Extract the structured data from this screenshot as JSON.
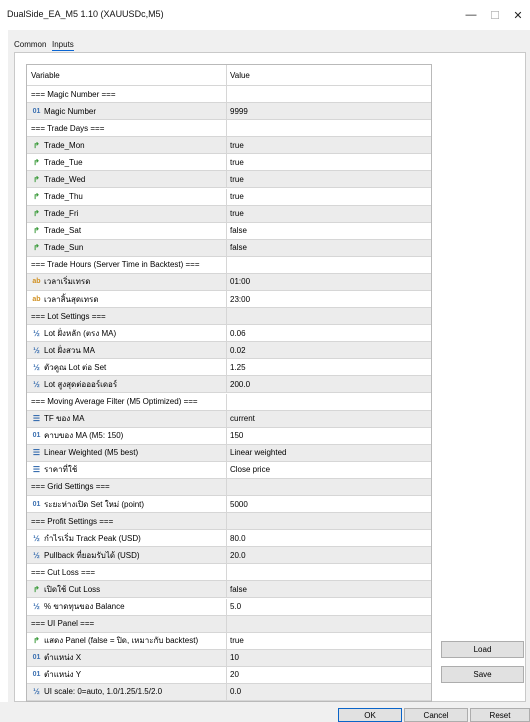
{
  "window": {
    "title": "DualSide_EA_M5 1.10 (XAUUSDc,M5)",
    "min": "—",
    "max": "☐",
    "close": "✕"
  },
  "tabs": [
    "Common",
    "Inputs"
  ],
  "grid": {
    "col_variable": "Variable",
    "col_value": "Value",
    "rows": [
      {
        "icon": "",
        "name": "=== Magic Number ===",
        "value": "",
        "alt": false
      },
      {
        "icon": "int",
        "name": "Magic Number",
        "value": "9999",
        "alt": true
      },
      {
        "icon": "",
        "name": "=== Trade Days ===",
        "value": "",
        "alt": false
      },
      {
        "icon": "bool",
        "name": "Trade_Mon",
        "value": "true",
        "alt": true
      },
      {
        "icon": "bool",
        "name": "Trade_Tue",
        "value": "true",
        "alt": false
      },
      {
        "icon": "bool",
        "name": "Trade_Wed",
        "value": "true",
        "alt": true
      },
      {
        "icon": "bool",
        "name": "Trade_Thu",
        "value": "true",
        "alt": false
      },
      {
        "icon": "bool",
        "name": "Trade_Fri",
        "value": "true",
        "alt": true
      },
      {
        "icon": "bool",
        "name": "Trade_Sat",
        "value": "false",
        "alt": false
      },
      {
        "icon": "bool",
        "name": "Trade_Sun",
        "value": "false",
        "alt": true
      },
      {
        "icon": "",
        "name": "=== Trade Hours (Server Time in Backtest) ===",
        "value": "",
        "alt": false
      },
      {
        "icon": "str",
        "name": "เวลาเริ่มเทรด",
        "value": "01:00",
        "alt": true
      },
      {
        "icon": "str",
        "name": "เวลาสิ้นสุดเทรด",
        "value": "23:00",
        "alt": false
      },
      {
        "icon": "",
        "name": "=== Lot Settings ===",
        "value": "",
        "alt": true
      },
      {
        "icon": "dbl",
        "name": "Lot ฝั่งหลัก (ตรง MA)",
        "value": "0.06",
        "alt": false
      },
      {
        "icon": "dbl",
        "name": "Lot ฝั่งสวน MA",
        "value": "0.02",
        "alt": true
      },
      {
        "icon": "dbl",
        "name": "ตัวคูณ Lot ต่อ Set",
        "value": "1.25",
        "alt": false
      },
      {
        "icon": "dbl",
        "name": "Lot สูงสุดต่อออร์เดอร์",
        "value": "200.0",
        "alt": true
      },
      {
        "icon": "",
        "name": "=== Moving Average Filter (M5 Optimized) ===",
        "value": "",
        "alt": false
      },
      {
        "icon": "enum",
        "name": "TF ของ MA",
        "value": "current",
        "alt": true
      },
      {
        "icon": "int",
        "name": "คาบของ MA (M5: 150)",
        "value": "150",
        "alt": false
      },
      {
        "icon": "enum",
        "name": "Linear Weighted (M5 best)",
        "value": "Linear weighted",
        "alt": true
      },
      {
        "icon": "enum",
        "name": "ราคาที่ใช้",
        "value": "Close price",
        "alt": false
      },
      {
        "icon": "",
        "name": "=== Grid Settings ===",
        "value": "",
        "alt": true
      },
      {
        "icon": "int",
        "name": "ระยะห่างเปิด Set ใหม่ (point)",
        "value": "5000",
        "alt": false
      },
      {
        "icon": "",
        "name": "=== Profit Settings ===",
        "value": "",
        "alt": true
      },
      {
        "icon": "dbl",
        "name": "กำไรเริ่ม Track Peak (USD)",
        "value": "80.0",
        "alt": false
      },
      {
        "icon": "dbl",
        "name": "Pullback ที่ยอมรับได้ (USD)",
        "value": "20.0",
        "alt": true
      },
      {
        "icon": "",
        "name": "=== Cut Loss ===",
        "value": "",
        "alt": false
      },
      {
        "icon": "bool",
        "name": "เปิดใช้ Cut Loss",
        "value": "false",
        "alt": true
      },
      {
        "icon": "dbl",
        "name": "% ขาดทุนของ Balance",
        "value": "5.0",
        "alt": false
      },
      {
        "icon": "",
        "name": "=== UI Panel ===",
        "value": "",
        "alt": true
      },
      {
        "icon": "bool",
        "name": "แสดง Panel (false = ปิด, เหมาะกับ backtest)",
        "value": "true",
        "alt": false
      },
      {
        "icon": "int",
        "name": "ตำแหน่ง X",
        "value": "10",
        "alt": true
      },
      {
        "icon": "int",
        "name": "ตำแหน่ง Y",
        "value": "20",
        "alt": false
      },
      {
        "icon": "dbl",
        "name": "UI scale: 0=auto, 1.0/1.25/1.5/2.0",
        "value": "0.0",
        "alt": true
      }
    ]
  },
  "icons": {
    "int": "01",
    "bool": "↱",
    "str": "ab",
    "dbl": "½",
    "enum": "☰"
  },
  "buttons": {
    "load": "Load",
    "save": "Save",
    "ok": "OK",
    "cancel": "Cancel",
    "reset": "Reset"
  }
}
